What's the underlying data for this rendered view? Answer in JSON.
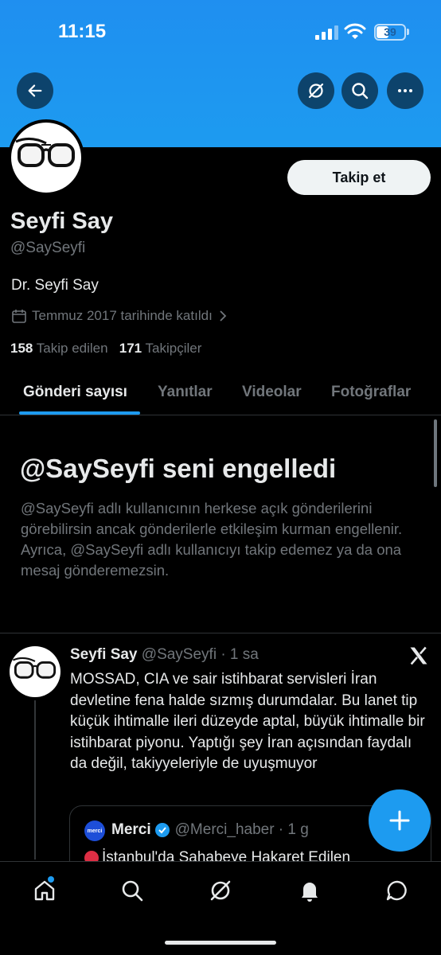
{
  "status_bar": {
    "time": "11:15",
    "battery": "39"
  },
  "header": {
    "back_icon": "arrow-left-icon",
    "grok_icon": "grok-icon",
    "search_icon": "search-icon",
    "more_icon": "more-horizontal-icon"
  },
  "profile": {
    "name": "Seyfi Say",
    "handle": "@SaySeyfi",
    "bio": "Dr. Seyfi Say",
    "joined": "Temmuz 2017 tarihinde katıldı",
    "following_count": "158",
    "following_label": "Takip edilen",
    "followers_count": "171",
    "followers_label": "Takipçiler",
    "follow_button": "Takip et"
  },
  "tabs": [
    {
      "label": "Gönderi sayısı",
      "active": true
    },
    {
      "label": "Yanıtlar",
      "active": false
    },
    {
      "label": "Videolar",
      "active": false
    },
    {
      "label": "Fotoğraflar",
      "active": false
    }
  ],
  "blocked": {
    "title": "@SaySeyfi seni engelledi",
    "text": "@SaySeyfi adlı kullanıcının herkese açık gönderilerini görebilirsin ancak gönderilerle etkileşim kurman engellenir. Ayrıca, @SaySeyfi adlı kullanıcıyı takip edemez ya da ona mesaj gönderemezsin."
  },
  "tweet": {
    "name": "Seyfi Say",
    "meta": "@SaySeyfi · 1 sa",
    "text": "MOSSAD, CIA ve sair istihbarat servisleri İran devletine fena halde sızmış durumdalar. Bu lanet tip küçük ihtimalle ileri düzeyde aptal, büyük ihtimalle bir istihbarat piyonu. Yaptığı şey İran açısından faydalı da değil, takiyyeleriyle de uyuşmuyor",
    "quote": {
      "avatar_text": "merci",
      "name": "Merci",
      "meta": "@Merci_haber · 1 g",
      "text": "İstanbul'da Sahabeye Hakaret Edilen"
    }
  },
  "colors": {
    "accent": "#1d9bf0",
    "background": "#000000",
    "muted": "#71767b"
  }
}
